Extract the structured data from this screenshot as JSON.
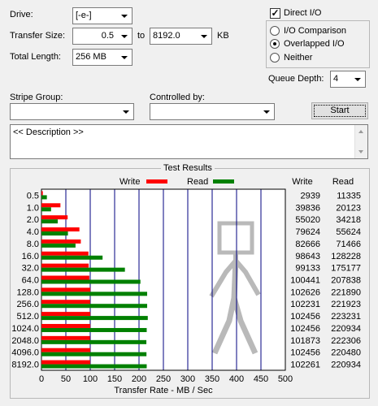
{
  "drive": {
    "label": "Drive:",
    "value": "[-e-]"
  },
  "transfer_size": {
    "label": "Transfer Size:",
    "from": "0.5",
    "to_label": "to",
    "to": "8192.0",
    "unit": "KB"
  },
  "total_length": {
    "label": "Total Length:",
    "value": "256 MB"
  },
  "direct_io": {
    "label": "Direct I/O",
    "checked": true
  },
  "io_mode": {
    "options": [
      {
        "label": "I/O Comparison",
        "selected": false
      },
      {
        "label": "Overlapped I/O",
        "selected": true
      },
      {
        "label": "Neither",
        "selected": false
      }
    ]
  },
  "queue_depth": {
    "label": "Queue Depth:",
    "value": "4"
  },
  "stripe_group": {
    "label": "Stripe Group:",
    "value": ""
  },
  "controlled_by": {
    "label": "Controlled by:",
    "value": ""
  },
  "start_button": {
    "label": "Start"
  },
  "description": {
    "text": "<< Description >>"
  },
  "results": {
    "title": "Test Results",
    "legend_write": "Write",
    "legend_read": "Read",
    "col_write": "Write",
    "col_read": "Read",
    "colors": {
      "write": "#ff0000",
      "read": "#008000",
      "grid": "#000080"
    }
  },
  "chart_data": {
    "type": "bar",
    "orientation": "horizontal",
    "xlabel": "Transfer Rate - MB / Sec",
    "xlim": [
      0,
      500
    ],
    "xticks": [
      0,
      50,
      100,
      150,
      200,
      250,
      300,
      350,
      400,
      450,
      500
    ],
    "categories": [
      "0.5",
      "1.0",
      "2.0",
      "4.0",
      "8.0",
      "16.0",
      "32.0",
      "64.0",
      "128.0",
      "256.0",
      "512.0",
      "1024.0",
      "2048.0",
      "4096.0",
      "8192.0"
    ],
    "series": [
      {
        "name": "Write",
        "values": [
          2.8,
          38.9,
          53.7,
          77.8,
          80.7,
          96.3,
          96.8,
          98.1,
          100.2,
          99.8,
          100.1,
          100.1,
          99.5,
          100.1,
          99.9
        ]
      },
      {
        "name": "Read",
        "values": [
          11.1,
          19.7,
          33.4,
          54.3,
          69.8,
          125.3,
          171.1,
          202.9,
          216.7,
          216.7,
          218.0,
          215.8,
          215.1,
          215.3,
          215.8
        ]
      }
    ],
    "write_kb": [
      "2939",
      "39836",
      "55020",
      "79624",
      "82666",
      "98643",
      "99133",
      "100441",
      "102626",
      "102231",
      "102456",
      "102456",
      "101873",
      "102456",
      "102261"
    ],
    "read_kb": [
      "11335",
      "20123",
      "34218",
      "55624",
      "71466",
      "128228",
      "175177",
      "207838",
      "221890",
      "221923",
      "223231",
      "220934",
      "222306",
      "220480",
      "220934"
    ]
  }
}
